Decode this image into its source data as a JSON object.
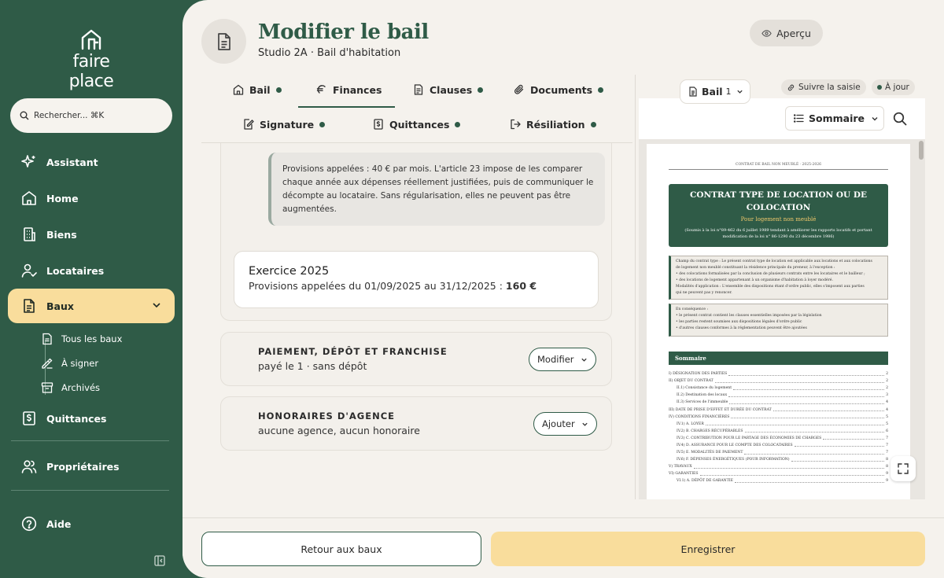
{
  "app": {
    "logo_text": "faire place"
  },
  "search": {
    "placeholder": "Rechercher... ⌘K"
  },
  "nav": {
    "assistant": "Assistant",
    "home": "Home",
    "biens": "Biens",
    "locataires": "Locataires",
    "baux": "Baux",
    "baux_sub": [
      "Tous les baux",
      "À signer",
      "Archivés"
    ],
    "quittances": "Quittances",
    "proprietaires": "Propriétaires",
    "aide": "Aide"
  },
  "header": {
    "title": "Modifier le bail",
    "subtitle": "Studio 2A · Bail d'habitation",
    "apercu": "Aperçu"
  },
  "tabs": [
    "Bail",
    "Finances",
    "Clauses",
    "Documents",
    "Signature",
    "Quittances",
    "Résiliation"
  ],
  "active_tab": "Finances",
  "finances": {
    "note": "Provisions appelées : 40 € par mois. L'article 23 impose de les comparer chaque année aux dépenses réellement justifiées, puis de communiquer le décompte au locataire. Sans régularisation, elles ne peuvent pas être augmentées.",
    "exercice_title": "Exercice 2025",
    "exercice_desc": "Provisions appelées du 01/09/2025 au 31/12/2025 : ",
    "exercice_amount": "160 €",
    "paiement_title": "PAIEMENT, DÉPÔT ET FRANCHISE",
    "paiement_desc": "payé le 1 · sans dépôt",
    "paiement_btn": "Modifier",
    "honoraires_title": "HONORAIRES D'AGENCE",
    "honoraires_desc": "aucune agence, aucun honoraire",
    "honoraires_btn": "Ajouter"
  },
  "preview": {
    "doc_select": "Bail",
    "doc_number": "1",
    "follow_chip": "Suivre la saisie",
    "status_chip": "À jour",
    "sommaire_btn": "Sommaire",
    "page": {
      "head": "CONTRAT DE BAIL NON MEUBLÉ · 2025-2026",
      "title": "CONTRAT TYPE DE LOCATION OU DE COLOCATION",
      "subtitle": "Pour logement non meublé",
      "legal": "(Soumis à la loi n°89-462 du 6 juillet 1989 tendant à améliorer les rapports locatifs et portant modification de la loi n° 86-1290 du 23 décembre 1986)",
      "box1": [
        "Champ du contrat type : Le présent contrat type de location est applicable aux locations et aux colocations",
        "de logement non meublé constituant la résidence principale du preneur, à l'exception :",
        "• des colocations formalisées par la conclusion de plusieurs contrats entre les locataires et le bailleur ;",
        "• des locations de logement appartenant à un organisme d'habitation à loyer modéré.",
        "Modalités d'application : L'ensemble des dispositions étant d'ordre public, elles s'imposent aux parties",
        "qui ne peuvent pas y renoncer."
      ],
      "box2": [
        "En conséquence :",
        "• le présent contrat contient les clauses essentielles imposées par la législation",
        "• les parties restent soumises aux dispositions légales d'ordre public",
        "• d'autres clauses conformes à la réglementation peuvent être ajoutées"
      ],
      "sommaire": "Sommaire",
      "toc": [
        {
          "label": "I)  DÉSIGNATION DES PARTIES",
          "page": "2",
          "indent": 0
        },
        {
          "label": "II) OBJET DU CONTRAT",
          "page": "2",
          "indent": 0
        },
        {
          "label": "II.1)  Consistance du logement",
          "page": "2",
          "indent": 1
        },
        {
          "label": "II.2)  Destination des locaux",
          "page": "3",
          "indent": 1
        },
        {
          "label": "II.3)  Services de l'immeuble",
          "page": "4",
          "indent": 1
        },
        {
          "label": "III) DATE DE PRISE D'EFFET ET DURÉE DU CONTRAT",
          "page": "4",
          "indent": 0
        },
        {
          "label": "IV) CONDITIONS FINANCIÈRES",
          "page": "5",
          "indent": 0
        },
        {
          "label": "IV.1)  A. LOYER",
          "page": "5",
          "indent": 1
        },
        {
          "label": "IV.2)  B. CHARGES RÉCUPÉRABLES",
          "page": "6",
          "indent": 1
        },
        {
          "label": "IV.3)  C. CONTRIBUTION POUR LE PARTAGE DES ÉCONOMIES DE CHARGES",
          "page": "7",
          "indent": 1
        },
        {
          "label": "IV.4)  D. ASSURANCE POUR LE COMPTE DES COLOCATAIRES",
          "page": "7",
          "indent": 1
        },
        {
          "label": "IV.5)  E. MODALITÉS DE PAIEMENT",
          "page": "7",
          "indent": 1
        },
        {
          "label": "IV.6)  F. DÉPENSES ÉNERGÉTIQUES (POUR INFORMATION)",
          "page": "8",
          "indent": 1
        },
        {
          "label": "V)  TRAVAUX",
          "page": "8",
          "indent": 0
        },
        {
          "label": "VI) GARANTIES",
          "page": "9",
          "indent": 0
        },
        {
          "label": "VI.1)  A. DÉPÔT DE GARANTIE",
          "page": "9",
          "indent": 1
        }
      ]
    }
  },
  "footer": {
    "back": "Retour aux baux",
    "save": "Enregistrer"
  },
  "colors": {
    "brand": "#2f5b47",
    "accent": "#f9dd9c",
    "background": "#f5f2ed"
  }
}
